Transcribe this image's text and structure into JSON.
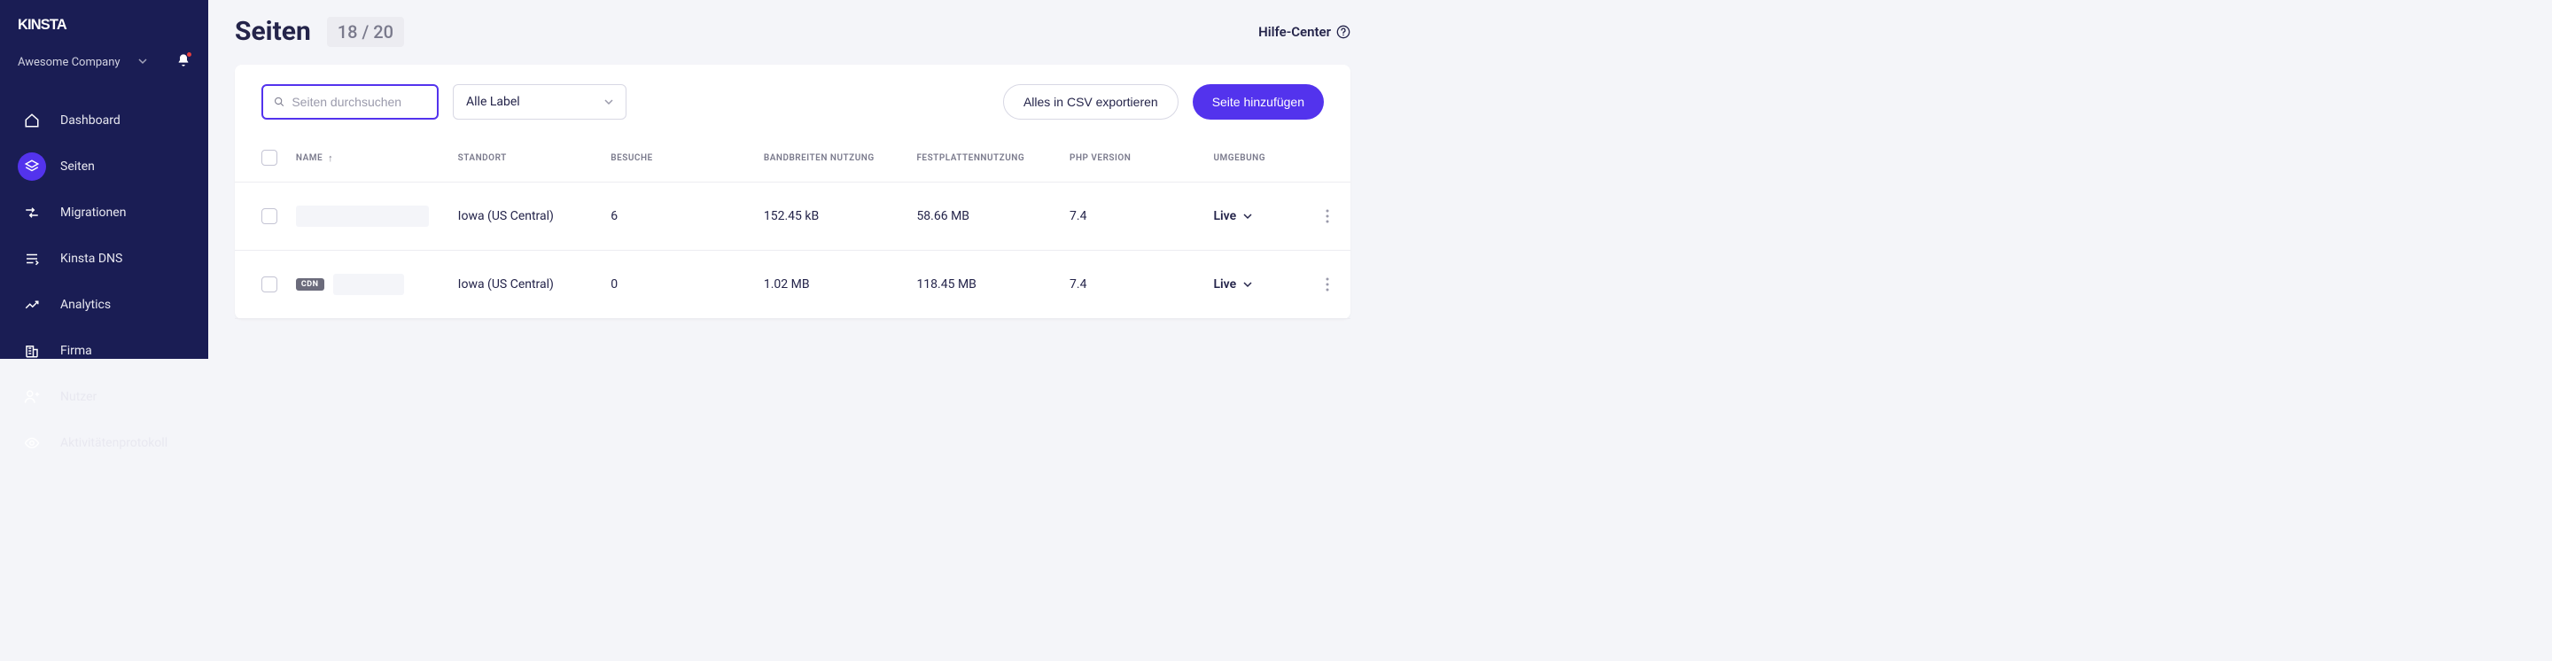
{
  "brand": "KINSTA",
  "company": {
    "name": "Awesome Company"
  },
  "nav": {
    "dashboard": "Dashboard",
    "seiten": "Seiten",
    "migrationen": "Migrationen",
    "kinsta_dns": "Kinsta DNS",
    "analytics": "Analytics",
    "firma": "Firma",
    "nutzer": "Nutzer",
    "aktivitaet": "Aktivitätenprotokoll"
  },
  "header": {
    "title": "Seiten",
    "count": "18 / 20",
    "help": "Hilfe-Center"
  },
  "toolbar": {
    "search_placeholder": "Seiten durchsuchen",
    "label_filter": "Alle Label",
    "export_csv": "Alles in CSV exportieren",
    "add_site": "Seite hinzufügen"
  },
  "table": {
    "headers": {
      "name": "NAME",
      "location": "STANDORT",
      "visits": "BESUCHE",
      "bandwidth": "BANDBREITEN NUTZUNG",
      "disk": "FESTPLATTENNUTZUNG",
      "php": "PHP VERSION",
      "env": "UMGEBUNG"
    },
    "rows": [
      {
        "cdn": false,
        "location": "Iowa (US Central)",
        "visits": "6",
        "bandwidth": "152.45 kB",
        "disk": "58.66 MB",
        "php": "7.4",
        "env": "Live"
      },
      {
        "cdn": true,
        "cdn_label": "CDN",
        "location": "Iowa (US Central)",
        "visits": "0",
        "bandwidth": "1.02 MB",
        "disk": "118.45 MB",
        "php": "7.4",
        "env": "Live"
      }
    ]
  }
}
